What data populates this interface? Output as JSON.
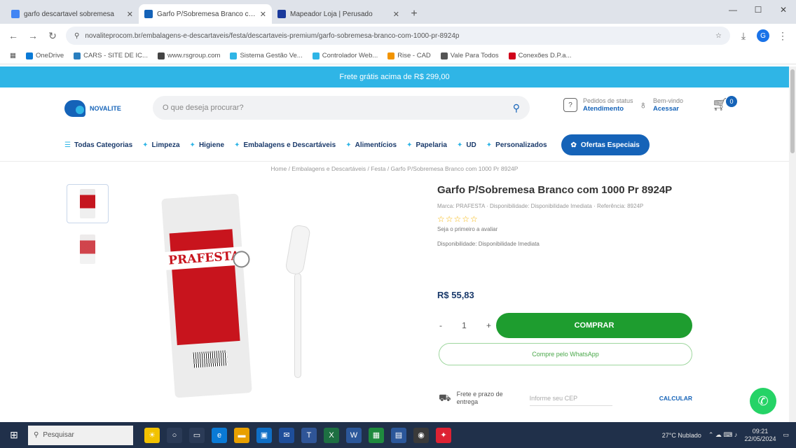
{
  "browser": {
    "tabs": [
      {
        "title": "garfo descartavel sobremesa",
        "color": "#4285f4",
        "active": false
      },
      {
        "title": "Garfo P/Sobremesa Branco com",
        "color": "#1563b8",
        "active": true
      },
      {
        "title": "Mapeador Loja | Perusado",
        "color": "#1a3a9c",
        "active": false
      }
    ],
    "new_tab": "+",
    "url": "novaliteprocom.br/embalagens-e-descartaveis/festa/descartaveis-premium/garfo-sobremesa-branco-com-1000-pr-8924p",
    "bookmarks": [
      {
        "label": "OneDrive",
        "color": "#0a7ad6"
      },
      {
        "label": "CARS - SITE DE IC...",
        "color": "#2a7fbf"
      },
      {
        "label": "www.rsgroup.com",
        "color": "#444"
      },
      {
        "label": "Sistema Gestão Ve...",
        "color": "#2fb5e6"
      },
      {
        "label": "Controlador Web...",
        "color": "#2fb5e6"
      },
      {
        "label": "Rise - CAD",
        "color": "#f29400"
      },
      {
        "label": "Vale Para Todos",
        "color": "#555"
      },
      {
        "label": "Conexões D.P.a...",
        "color": "#d0021b"
      }
    ]
  },
  "promo_text": "Frete grátis acima de R$ 299,00",
  "header": {
    "logo_text": "NOVALITE",
    "search_placeholder": "O que deseja procurar?",
    "track_label": "Pedidos de status",
    "track_value": "Atendimento",
    "login_label": "Bem-vindo",
    "login_value": "Acessar",
    "cart_count": "0"
  },
  "categories": [
    {
      "label": "Todas Categorias",
      "icon": "☰"
    },
    {
      "label": "Limpeza",
      "icon": "✦"
    },
    {
      "label": "Higiene",
      "icon": "✦"
    },
    {
      "label": "Embalagens e Descartáveis",
      "icon": "✦"
    },
    {
      "label": "Alimentícios",
      "icon": "✦"
    },
    {
      "label": "Papelaria",
      "icon": "✦"
    },
    {
      "label": "UD",
      "icon": "✦"
    },
    {
      "label": "Personalizados",
      "icon": "✦"
    }
  ],
  "offers_label": "Ofertas Especiais",
  "breadcrumb": "Home / Embalagens e Descartáveis / Festa / Garfo P/Sobremesa Branco com 1000 Pr 8924P",
  "product": {
    "title": "Garfo P/Sobremesa Branco com 1000 Pr 8924P",
    "meta": "Marca: PRAFESTA · Disponibilidade: Disponibilidade Imediata · Referência: 8924P",
    "stars": "☆☆☆☆☆",
    "review_link": "Seja o primeiro a avaliar",
    "availability": "Disponibilidade: Disponibilidade Imediata",
    "price": "R$ 55,83",
    "qty_minus": "-",
    "qty_value": "1",
    "qty_plus": "+",
    "buy_label": "COMPRAR",
    "whatsapp_buy": "Compre pelo WhatsApp",
    "shipping_label": "Frete e prazo de entrega",
    "cep_placeholder": "Informe seu CEP",
    "calc_label": "CALCULAR",
    "brand_on_pack": "PRAFESTA"
  },
  "taskbar": {
    "search_placeholder": "Pesquisar",
    "weather": "27°C Nublado",
    "time": "09:21",
    "date": "22/05/2024"
  }
}
